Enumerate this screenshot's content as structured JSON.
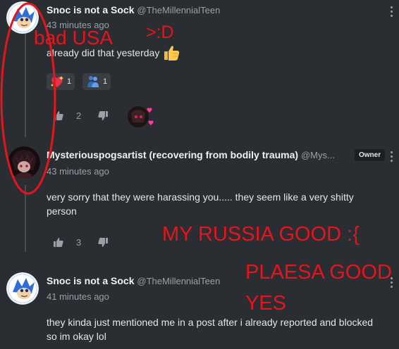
{
  "comments": [
    {
      "author": "Snoc is not a Sock",
      "handle": "@TheMillennialTeen",
      "time": "43 minutes ago",
      "text": "already did that yesterday",
      "reactions": [
        {
          "icon": "sparkling-heart-icon",
          "count": "1"
        },
        {
          "icon": "people-hugging-icon",
          "count": "1"
        }
      ],
      "upvotes": "2"
    },
    {
      "author": "Mysteriouspogsartist (recovering from bodily trauma)",
      "handle": "@Mys...",
      "badge": "Owner",
      "time": "43 minutes ago",
      "text": "very sorry that they were harassing you..... they seem like a very shitty person",
      "upvotes": "3"
    },
    {
      "author": "Snoc is not a Sock",
      "handle": "@TheMillennialTeen",
      "time": "41 minutes ago",
      "text": "they kinda just mentioned me in a post after i already reported and blocked so im okay lol"
    }
  ],
  "overlay": {
    "text1": "bad USA",
    "text2": ">:D",
    "text3": "MY RUSSIA GOOD :{",
    "text4_line1": "PLAESA GOOD",
    "text4_line2": "YES"
  },
  "colors": {
    "background": "#2a2d31",
    "overlay_red": "#e8141c",
    "muted": "#9aa0a6"
  }
}
